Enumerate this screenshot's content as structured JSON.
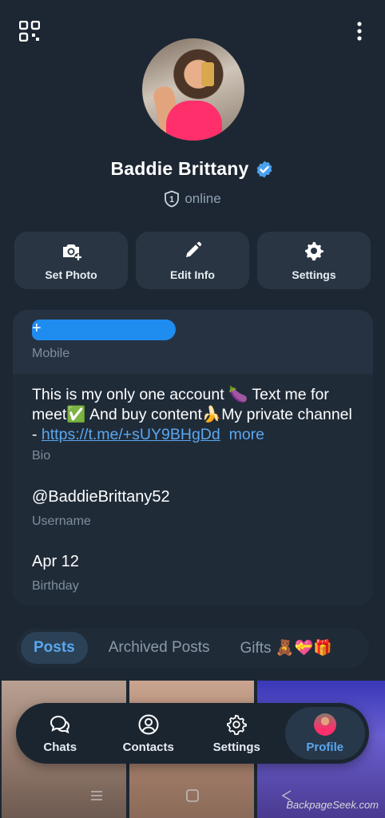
{
  "header": {
    "qr_icon": "qr-code-icon",
    "menu_icon": "more-vertical-icon"
  },
  "profile": {
    "name": "Baddie Brittany",
    "verified": true,
    "status_badge": "1",
    "status": "online"
  },
  "actions": [
    {
      "label": "Set Photo",
      "icon": "camera-add-icon"
    },
    {
      "label": "Edit Info",
      "icon": "pencil-icon"
    },
    {
      "label": "Settings",
      "icon": "gear-icon"
    }
  ],
  "info": {
    "phone_prefix": "+",
    "phone_label": "Mobile",
    "bio_text": "This is my only one account 🍆 Text me for meet✅ And buy content🍌My private channel - ",
    "bio_link": "https://t.me/+sUY9BHgDd",
    "bio_more": "more",
    "bio_label": "Bio",
    "username": "@BaddieBrittany52",
    "username_label": "Username",
    "birthday": "Apr 12",
    "birthday_label": "Birthday"
  },
  "tabs": [
    {
      "label": "Posts",
      "active": true
    },
    {
      "label": "Archived Posts",
      "active": false
    },
    {
      "label": "Gifts 🧸💝🎁",
      "active": false
    }
  ],
  "bottom_nav": [
    {
      "label": "Chats",
      "icon": "chat-bubbles-icon",
      "active": false
    },
    {
      "label": "Contacts",
      "icon": "person-circle-icon",
      "active": false
    },
    {
      "label": "Settings",
      "icon": "gear-icon",
      "active": false
    },
    {
      "label": "Profile",
      "icon": "avatar",
      "active": true
    }
  ],
  "watermark": "BackpageSeek.com",
  "colors": {
    "background": "#1d2733",
    "accent": "#5aa7f0",
    "card": "#202b38"
  }
}
